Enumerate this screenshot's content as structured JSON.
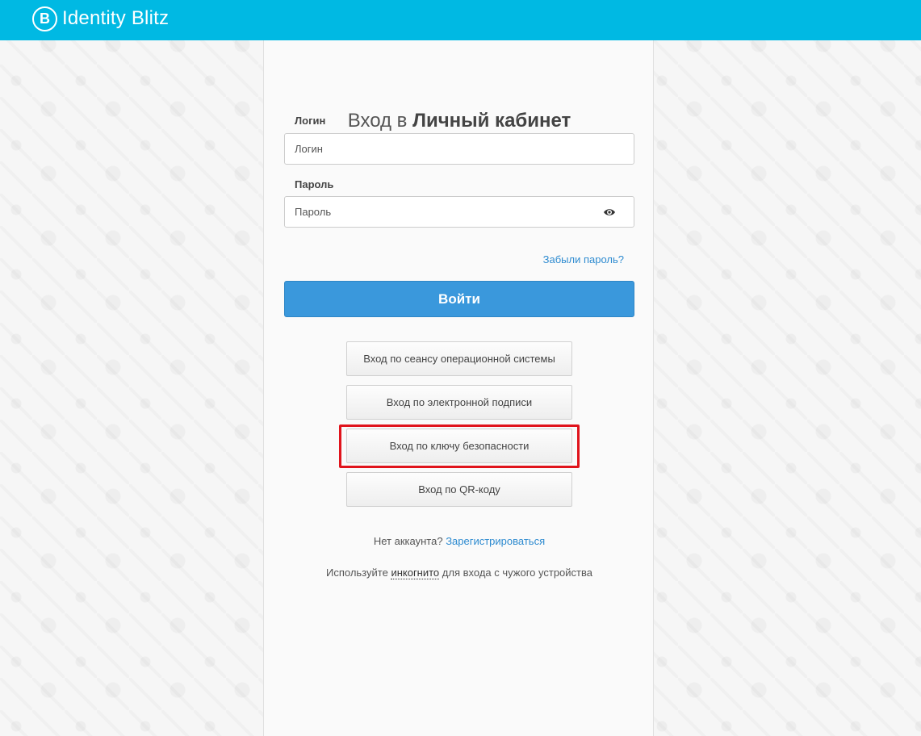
{
  "header": {
    "brand_mark": "B",
    "brand_name": "Identity Blitz",
    "color": "#00b9e3"
  },
  "form": {
    "title_prefix": "Вход в",
    "title_bold": "Личный кабинет",
    "login_label": "Логин",
    "login_placeholder": "Логин",
    "password_label": "Пароль",
    "password_placeholder": "Пароль",
    "forgot_link": "Забыли пароль?",
    "submit_label": "Войти",
    "submit_color": "#3a98dc"
  },
  "alt_logins": [
    {
      "label": "Вход по сеансу операционной системы"
    },
    {
      "label": "Вход по электронной подписи"
    },
    {
      "label": "Вход по ключу безопасности"
    },
    {
      "label": "Вход по QR-коду"
    }
  ],
  "footer": {
    "no_account": "Нет аккаунта?",
    "register_link": "Зарегистрироваться",
    "incognito_prefix": "Используйте",
    "incognito_link": "инкогнито",
    "incognito_suffix": "для входа с чужого устройства"
  }
}
